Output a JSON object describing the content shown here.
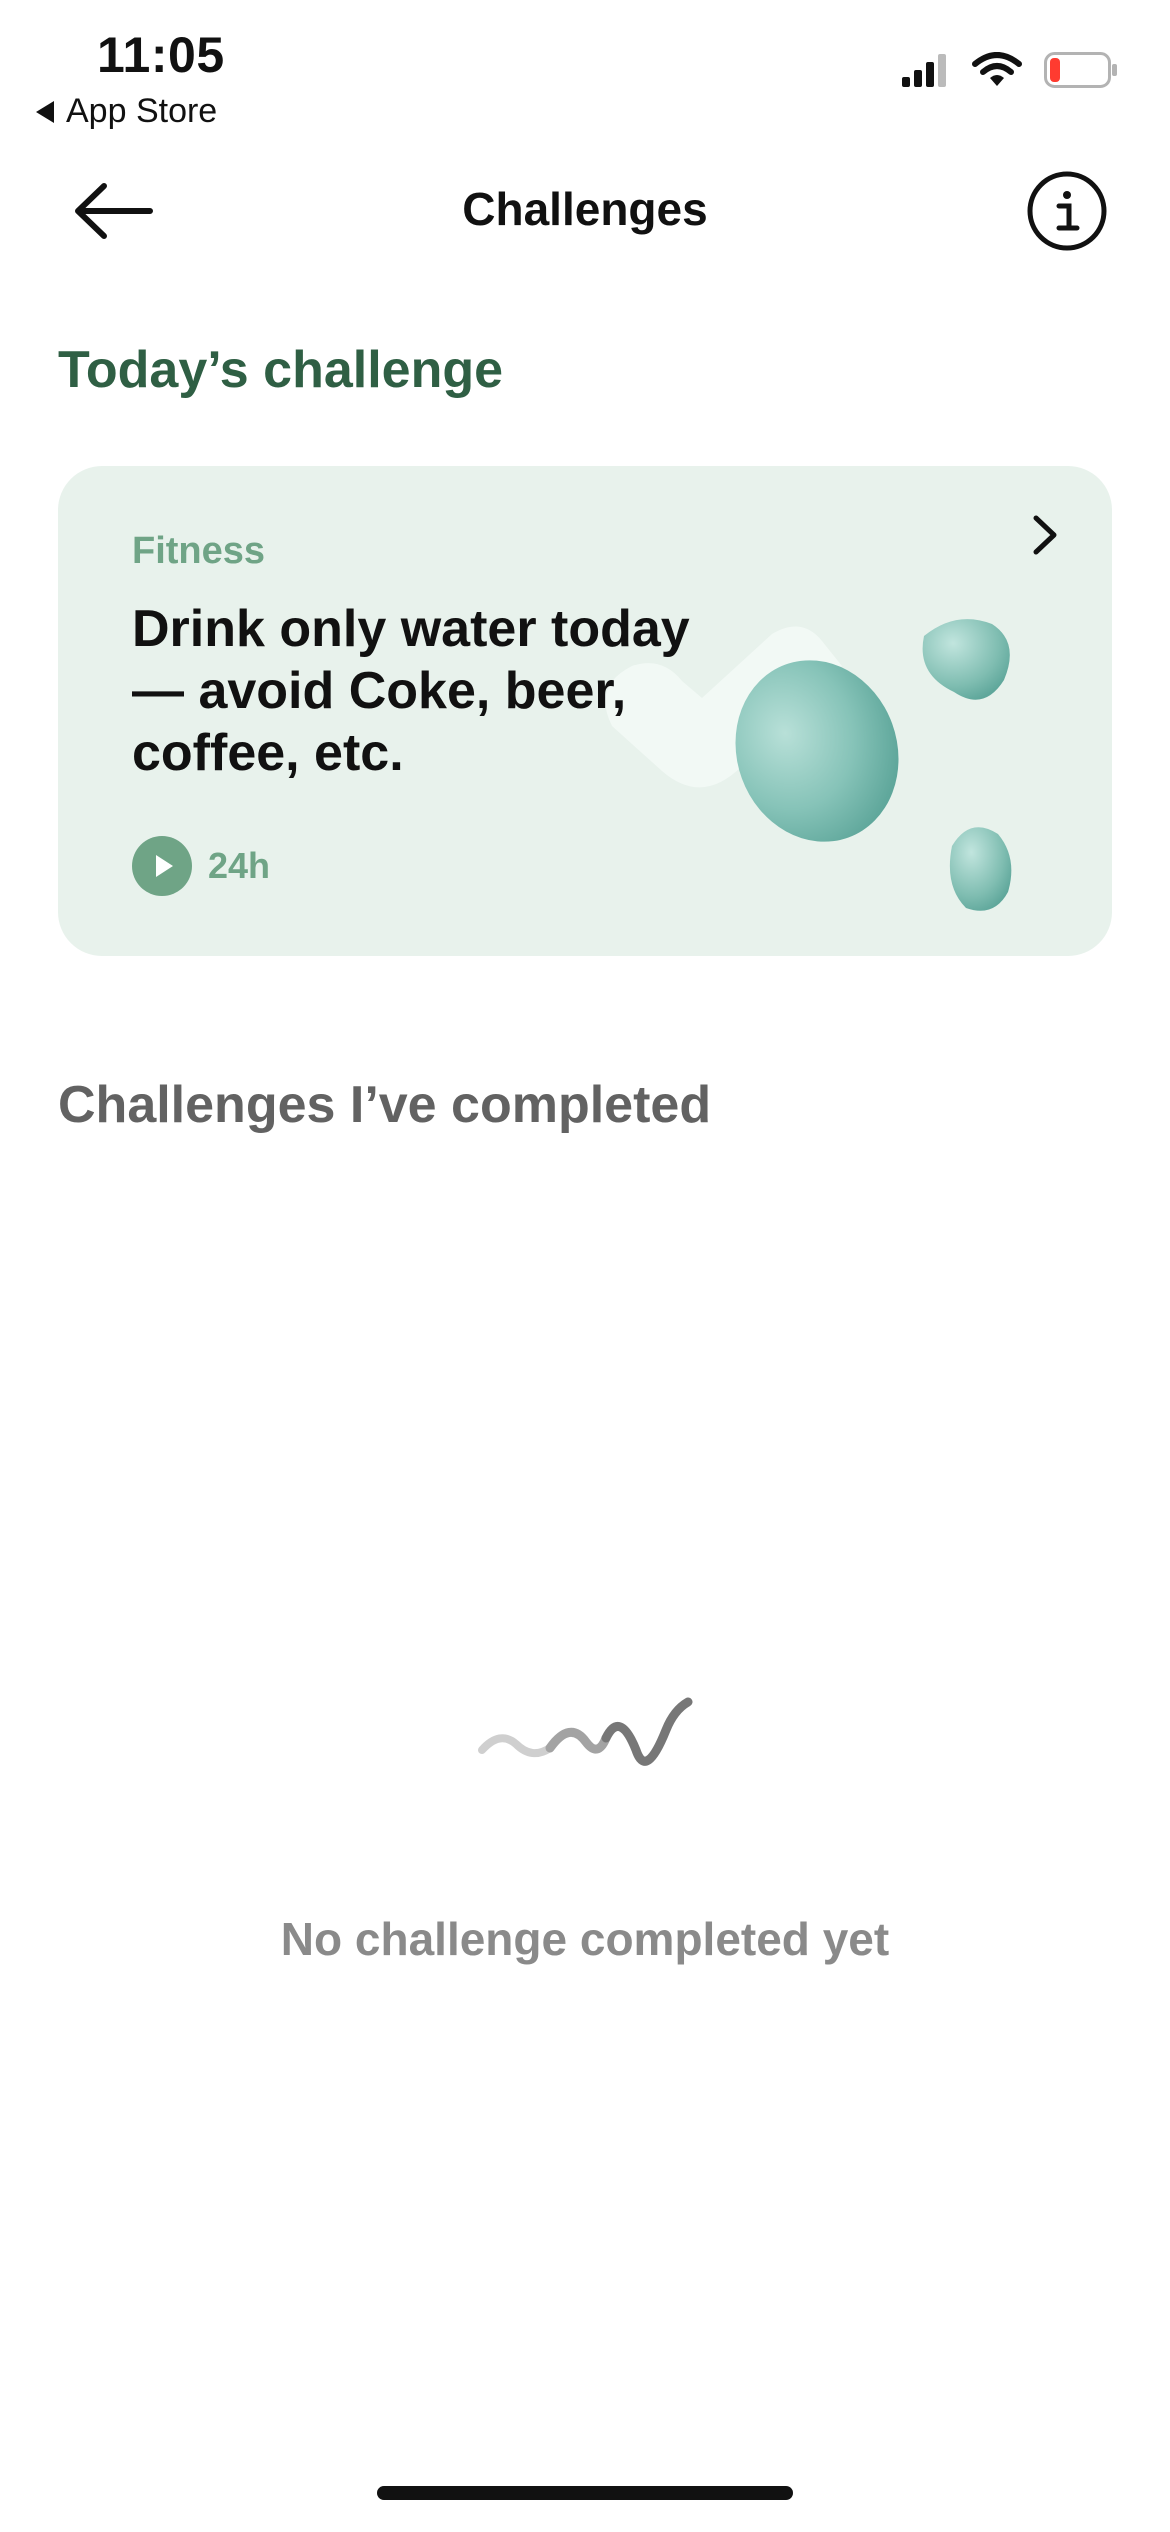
{
  "status_bar": {
    "time": "11:05",
    "back_app_label": "App Store",
    "icons": [
      "signal-icon",
      "wifi-icon",
      "battery-low-icon"
    ],
    "battery_color": "#ff3b30"
  },
  "nav": {
    "title": "Challenges",
    "back_icon": "arrow-left-icon",
    "info_icon": "info-icon"
  },
  "today": {
    "section_title": "Today’s challenge",
    "card": {
      "category": "Fitness",
      "text": "Drink only water today — avoid Coke, beer, coffee, etc.",
      "duration": "24h",
      "chevron_icon": "chevron-right-icon",
      "background_color": "#e8f2ec",
      "accent_color": "#6fa486"
    }
  },
  "completed": {
    "section_title": "Challenges I’ve completed",
    "empty_message": "No challenge completed yet",
    "empty_icon": "squiggle-icon"
  },
  "colors": {
    "title_green": "#2f5f44",
    "heading_gray": "#626262",
    "muted_text": "#8a8a8a"
  }
}
